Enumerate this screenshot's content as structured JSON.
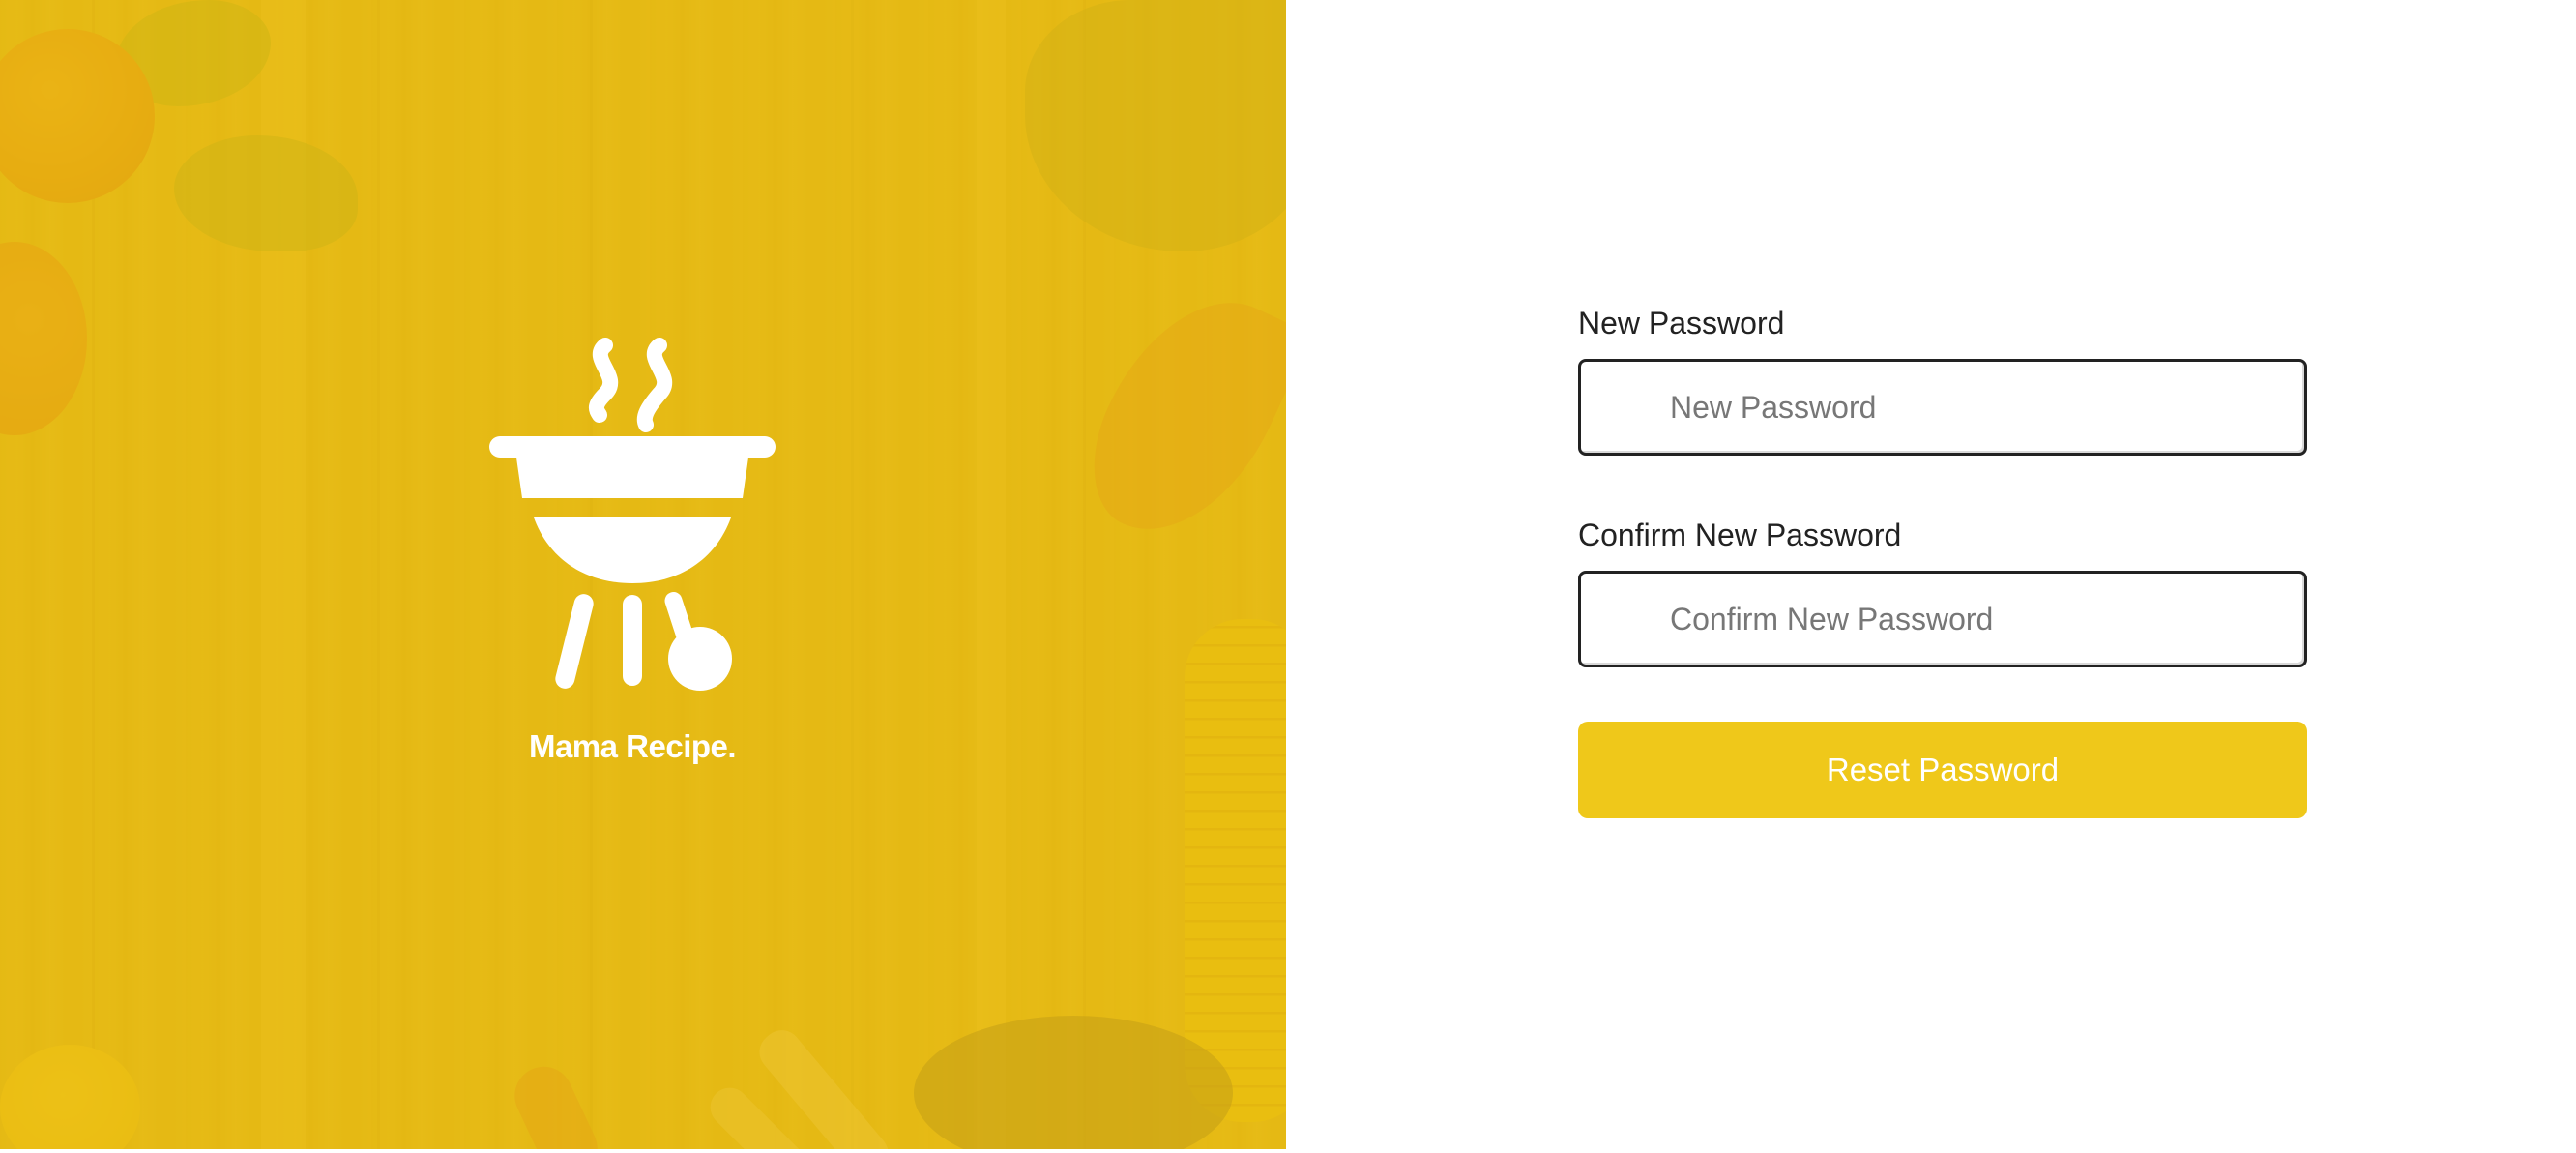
{
  "hero": {
    "brand_name": "Mama Recipe.",
    "logo_icon": "grill-icon"
  },
  "form": {
    "new_password": {
      "label": "New Password",
      "placeholder": "New Password",
      "value": ""
    },
    "confirm_password": {
      "label": "Confirm New Password",
      "placeholder": "Confirm New Password",
      "value": ""
    },
    "submit_label": "Reset Password"
  },
  "colors": {
    "accent": "#efc81a",
    "hero_overlay": "#e6ba14",
    "text": "#222222"
  }
}
